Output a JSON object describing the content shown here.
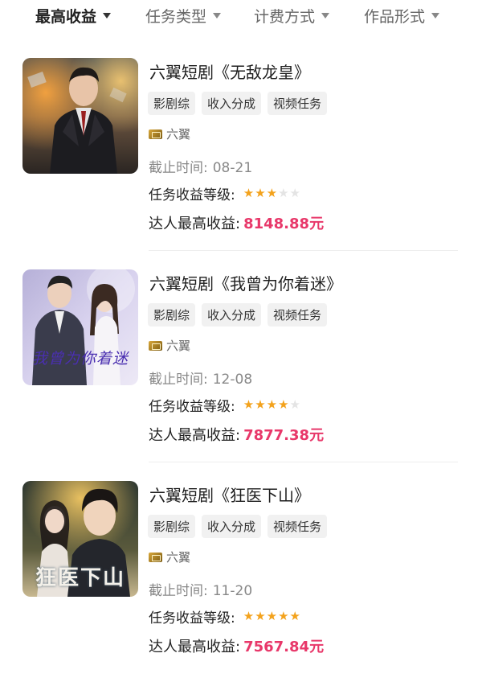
{
  "filters": [
    {
      "label": "最高收益",
      "active": true
    },
    {
      "label": "任务类型",
      "active": false
    },
    {
      "label": "计费方式",
      "active": false
    },
    {
      "label": "作品形式",
      "active": false
    }
  ],
  "labels": {
    "deadline": "截止时间:",
    "level": "任务收益等级:",
    "income": "达人最高收益:"
  },
  "items": [
    {
      "title": "六翼短剧《无敌龙皇》",
      "tags": [
        "影剧综",
        "收入分成",
        "视频任务"
      ],
      "author": "六翼",
      "deadline": "08-21",
      "stars": 3,
      "income": "8148.88元"
    },
    {
      "title": "六翼短剧《我曾为你着迷》",
      "tags": [
        "影剧综",
        "收入分成",
        "视频任务"
      ],
      "author": "六翼",
      "deadline": "12-08",
      "stars": 4,
      "income": "7877.38元",
      "thumb_caption": "我曾为你着迷"
    },
    {
      "title": "六翼短剧《狂医下山》",
      "tags": [
        "影剧综",
        "收入分成",
        "视频任务"
      ],
      "author": "六翼",
      "deadline": "11-20",
      "stars": 5,
      "income": "7567.84元",
      "thumb_caption": "狂医下山"
    }
  ]
}
